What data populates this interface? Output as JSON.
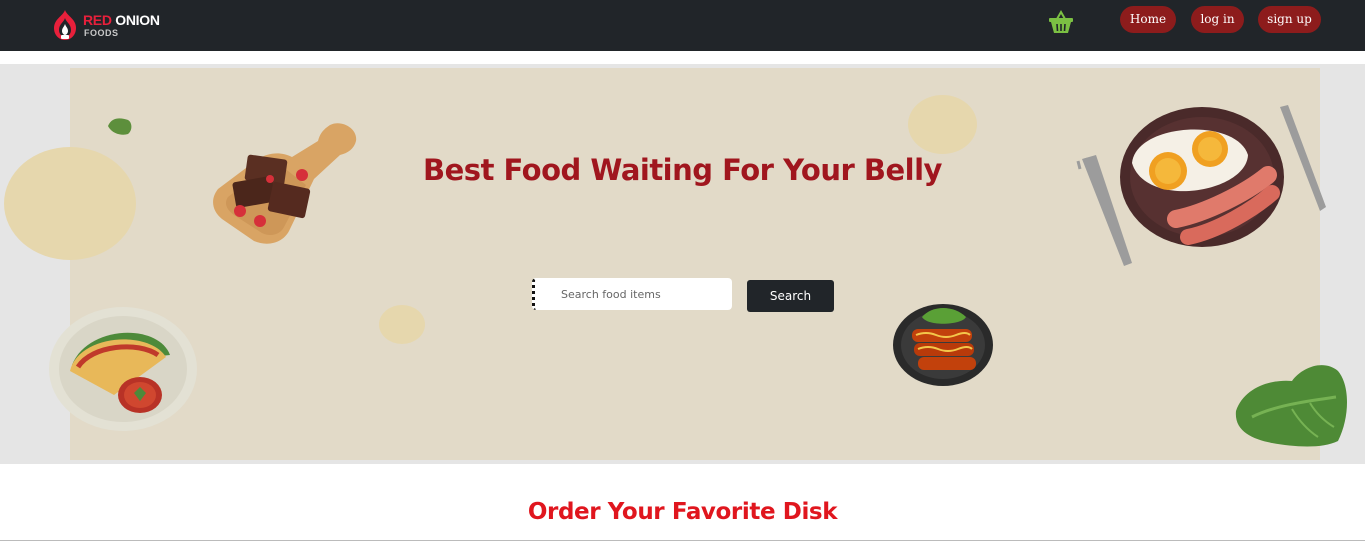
{
  "brand": {
    "name_part1": "RED",
    "name_part2": "ONION",
    "sub": "FOODS"
  },
  "nav": {
    "home": "Home",
    "login": "log in",
    "signup": "sign up"
  },
  "hero": {
    "title": "Best Food Waiting For Your Belly",
    "search_placeholder": "Search food items",
    "search_button": "Search"
  },
  "section": {
    "title": "Order Your Favorite Disk"
  },
  "colors": {
    "navbar": "#212529",
    "nav_button": "#8d1c1c",
    "hero_title": "#a0161e",
    "section_title": "#e0161e",
    "hero_bg": "#e2dac8"
  },
  "icons": [
    "onion-logo-icon",
    "shopping-basket-icon"
  ]
}
